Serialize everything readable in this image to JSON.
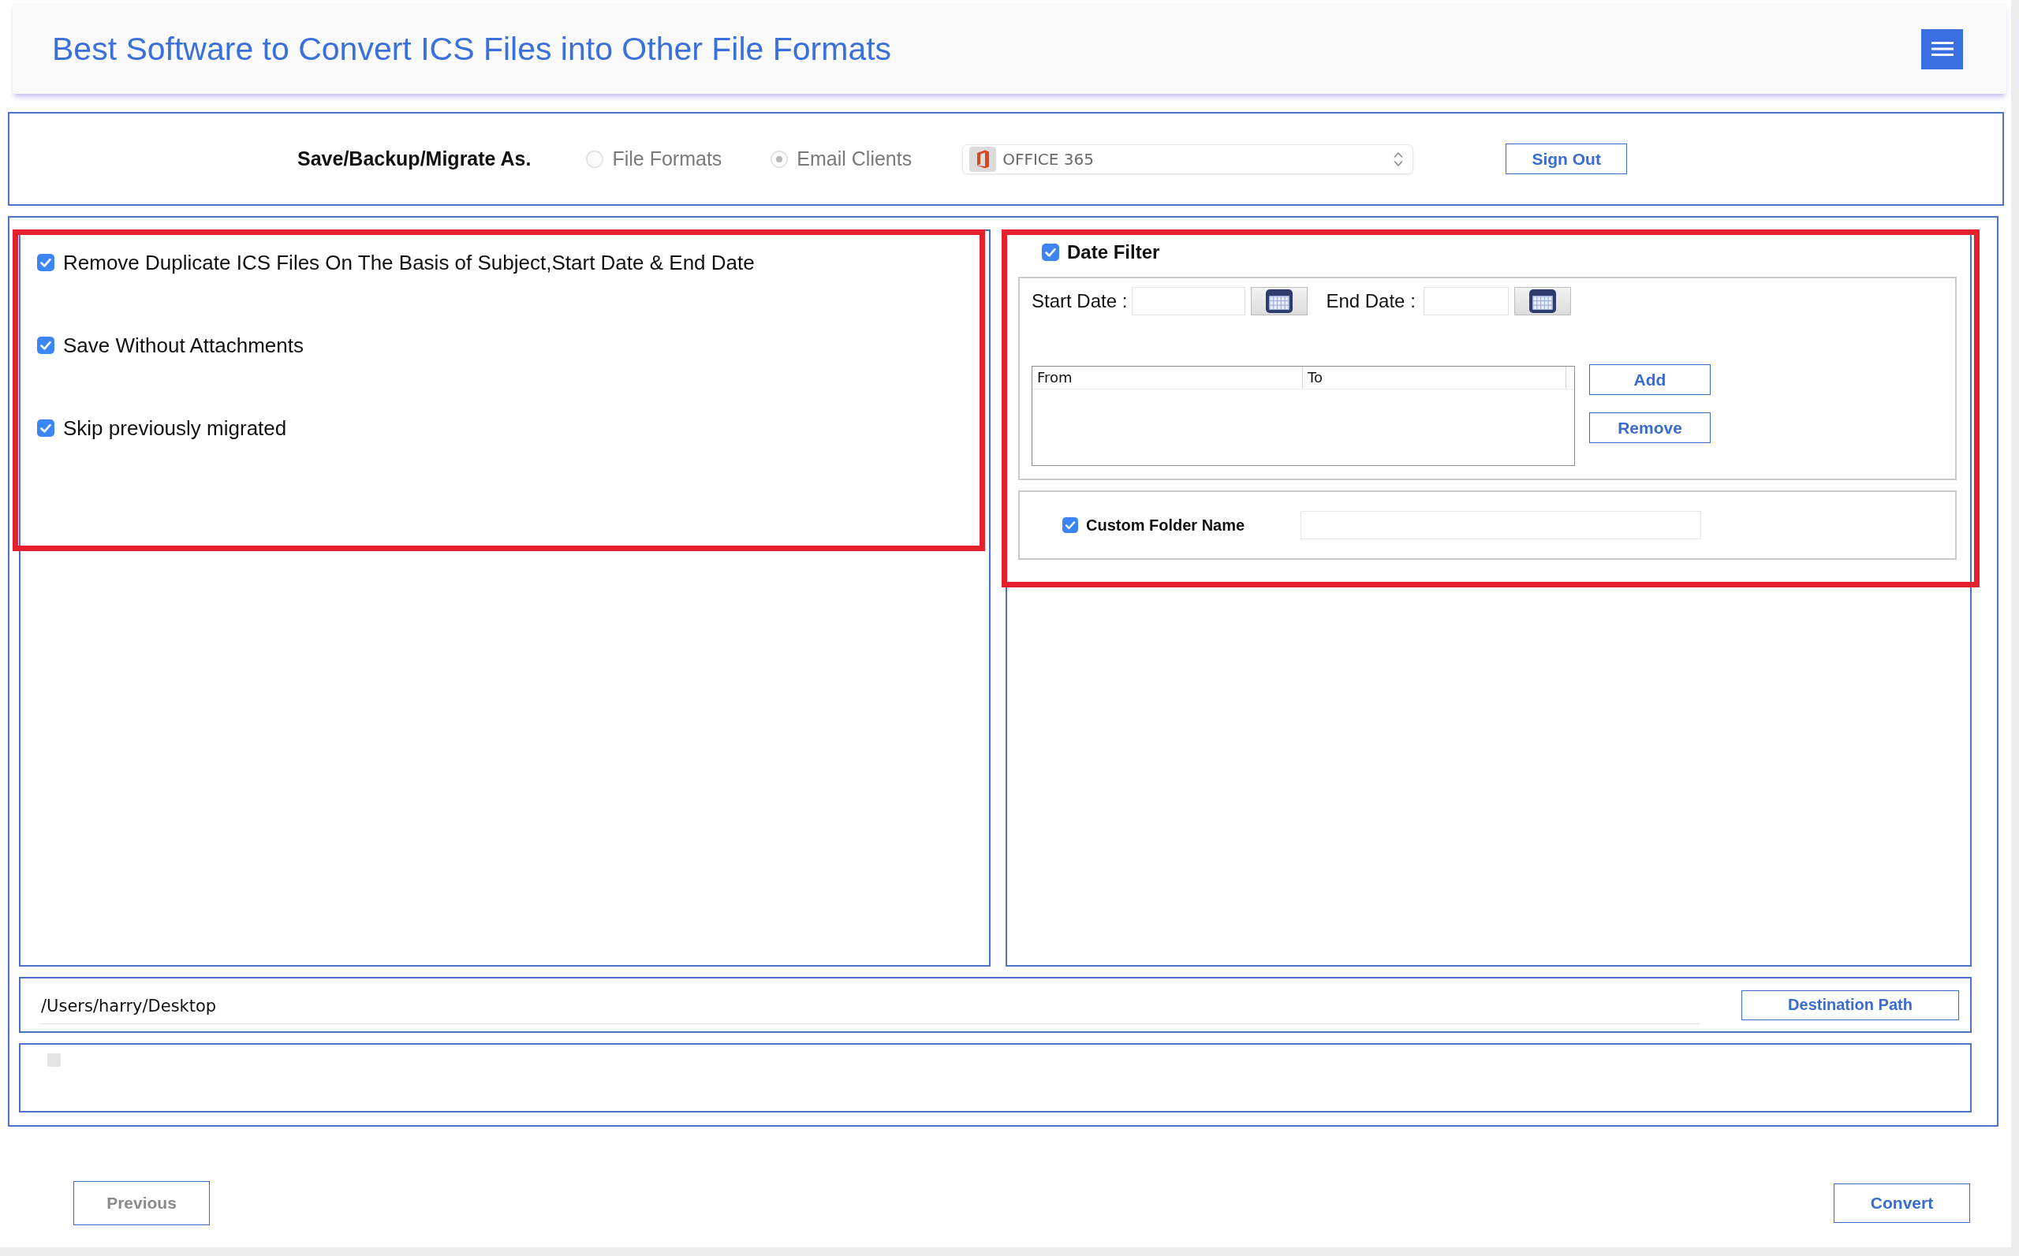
{
  "header": {
    "title": "Best Software to Convert ICS Files into Other File Formats"
  },
  "save_options": {
    "label": "Save/Backup/Migrate As.",
    "radios": [
      {
        "label": "File Formats",
        "selected": false,
        "disabled": true
      },
      {
        "label": "Email Clients",
        "selected": true,
        "disabled": true
      }
    ],
    "dropdown": {
      "value": "OFFICE 365"
    },
    "sign_out_button": "Sign Out"
  },
  "left_panel": {
    "highlighted": true,
    "options": [
      {
        "label": "Remove Duplicate ICS Files On The Basis of Subject,Start Date & End Date",
        "checked": true
      },
      {
        "label": "Save Without Attachments",
        "checked": true
      },
      {
        "label": "Skip previously migrated",
        "checked": true
      }
    ]
  },
  "right_panel": {
    "highlighted": true,
    "date_filter": {
      "label": "Date Filter",
      "checked": true,
      "start_date_label": "Start Date :",
      "end_date_label": "End Date :",
      "range_table": {
        "columns": [
          "From",
          "To"
        ]
      },
      "buttons": [
        "Add",
        "Remove"
      ]
    },
    "custom_folder": {
      "label": "Custom Folder Name",
      "checked": true
    }
  },
  "destination": {
    "path": "/Users/harry/Desktop",
    "button": "Destination Path"
  },
  "status_panel": {
    "checkbox": {
      "checked": false,
      "disabled": true
    }
  },
  "footer": {
    "buttons": [
      {
        "label": "Previous",
        "disabled": true
      },
      {
        "label": "Convert",
        "disabled": false
      }
    ]
  }
}
